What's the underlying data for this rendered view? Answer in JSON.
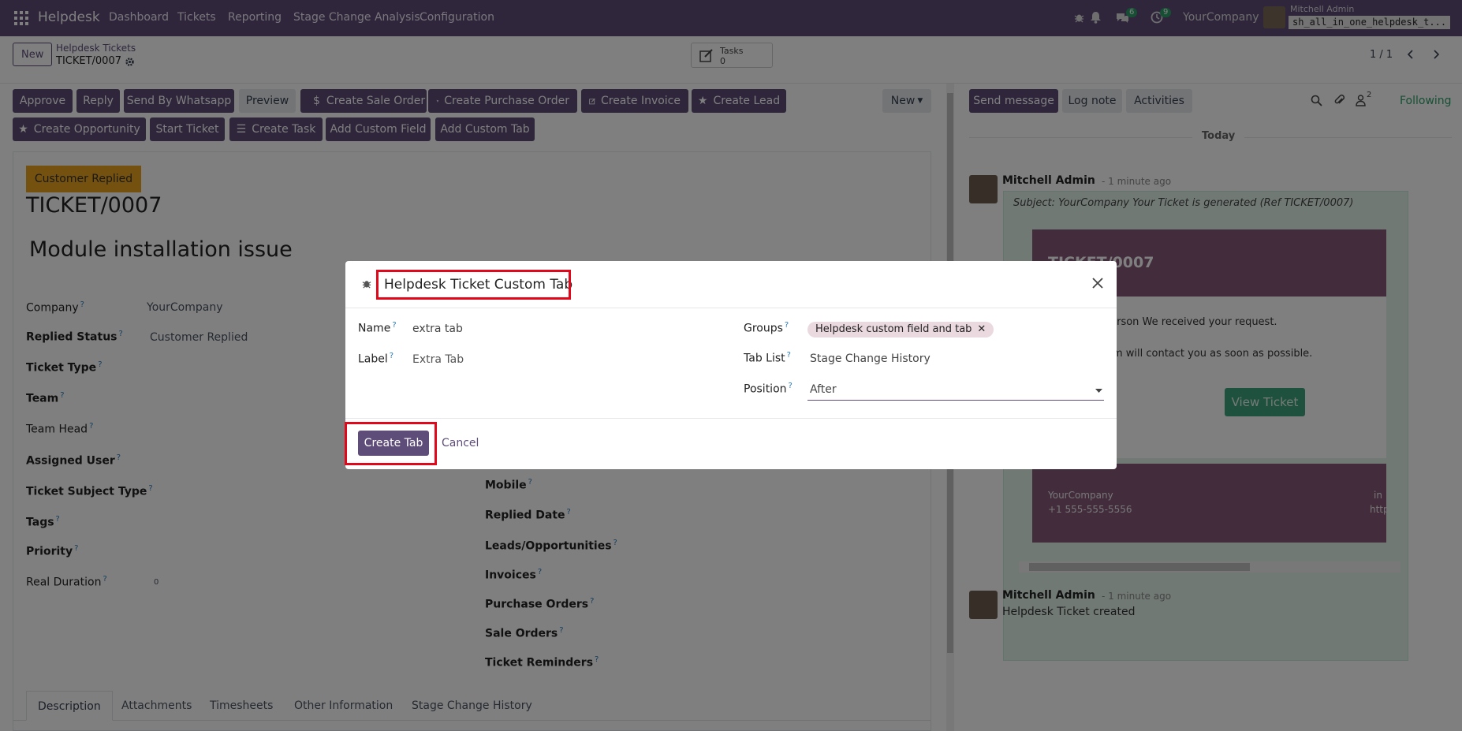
{
  "nav": {
    "brand": "Helpdesk",
    "menu": [
      "Dashboard",
      "Tickets",
      "Reporting",
      "Stage Change Analysis",
      "Configuration"
    ],
    "messages_count": "6",
    "activities_count": "9",
    "company": "YourCompany",
    "user_name": "Mitchell Admin",
    "db_name": "sh_all_in_one_helpdesk_t..."
  },
  "control_panel": {
    "new_label": "New",
    "breadcrumb_parent": "Helpdesk Tickets",
    "breadcrumb_current": "TICKET/0007",
    "tasks_label": "Tasks",
    "tasks_count": "0",
    "pager": "1 / 1"
  },
  "actions_row1": [
    "Approve",
    "Reply",
    "Send By Whatsapp",
    "Preview",
    "Create Sale Order",
    "Create Purchase Order",
    "Create Invoice",
    "Create Lead"
  ],
  "actions_row2": [
    "Create Opportunity",
    "Start Ticket",
    "Create Task",
    "Add Custom Field",
    "Add Custom Tab"
  ],
  "new_dropdown_label": "New",
  "form": {
    "status_badge": "Customer Replied",
    "ticket_number": "TICKET/0007",
    "subject": "Module installation issue",
    "left_fields": [
      {
        "label": "Company",
        "value": "YourCompany"
      },
      {
        "label": "Replied Status",
        "value": "Customer Replied"
      },
      {
        "label": "Ticket Type",
        "value": ""
      },
      {
        "label": "Team",
        "value": ""
      },
      {
        "label": "Team Head",
        "value": ""
      },
      {
        "label": "Assigned User",
        "value": ""
      },
      {
        "label": "Ticket Subject Type",
        "value": ""
      },
      {
        "label": "Tags",
        "value": ""
      },
      {
        "label": "Priority",
        "value": ""
      },
      {
        "label": "Real Duration",
        "value": "0"
      }
    ],
    "right_fields": [
      "Mobile",
      "Replied Date",
      "Leads/Opportunities",
      "Invoices",
      "Purchase Orders",
      "Sale Orders",
      "Ticket Reminders"
    ],
    "tabs": [
      "Description",
      "Attachments",
      "Timesheets",
      "Other Information",
      "Stage Change History"
    ]
  },
  "chatter": {
    "send_message": "Send message",
    "log_note": "Log note",
    "activities": "Activities",
    "followers_count": "2",
    "following": "Following",
    "date_separator": "Today",
    "messages": [
      {
        "author": "Mitchell Admin",
        "time": "- 1 minute ago",
        "subject": "Subject: YourCompany Your Ticket is generated (Ref TICKET/0007)"
      },
      {
        "author": "Mitchell Admin",
        "time": "- 1 minute ago",
        "body": "Helpdesk Ticket created"
      }
    ],
    "email": {
      "header": "TICKET/0007",
      "line1": "eterson We received your request.",
      "line2": "eam will contact you as soon as possible.",
      "view_button": "View Ticket",
      "footer_company": "YourCompany",
      "footer_phone": "+1 555-555-5556",
      "footer_right1": "in",
      "footer_right2": "http"
    }
  },
  "dialog": {
    "title": "Helpdesk Ticket Custom Tab",
    "name_label": "Name",
    "name_value": "extra tab",
    "label_label": "Label",
    "label_value": "Extra Tab",
    "groups_label": "Groups",
    "groups_tag": "Helpdesk custom field and tab",
    "tablist_label": "Tab List",
    "tablist_value": "Stage Change History",
    "position_label": "Position",
    "position_value": "After",
    "create_label": "Create Tab",
    "cancel_label": "Cancel"
  },
  "colors": {
    "brand": "#5e4c79",
    "badge_warning": "#e9a31c",
    "success": "#2e9f6a",
    "highlight": "#e0081a"
  }
}
